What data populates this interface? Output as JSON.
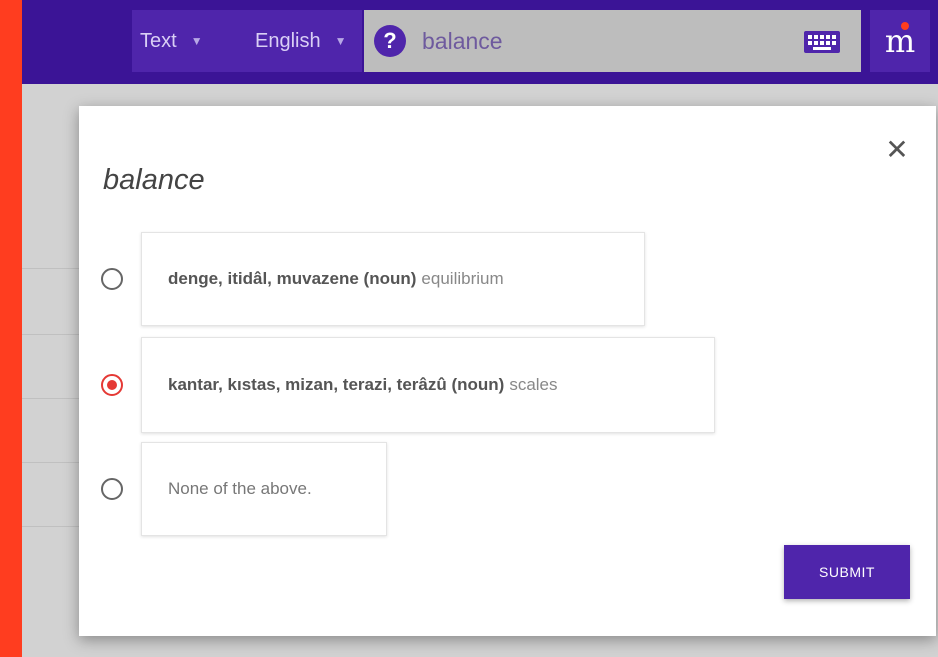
{
  "toolbar": {
    "mode_label": "Text",
    "language_label": "English",
    "search_value": "balance",
    "help_icon": "question-circle-icon",
    "keyboard_icon": "keyboard-icon",
    "brand_letter": "m"
  },
  "dialog": {
    "title": "balance",
    "close_symbol": "✕",
    "options": [
      {
        "terms": "denge, itidâl, muvazene (noun)",
        "gloss": "equilibrium",
        "selected": false
      },
      {
        "terms": "kantar, kıstas, mizan, terazi, terâzû (noun)",
        "gloss": "scales",
        "selected": true
      },
      {
        "terms": "",
        "gloss": "None of the above.",
        "selected": false
      }
    ],
    "submit_label": "SUBMIT"
  },
  "colors": {
    "topbar": "#3b1496",
    "accent": "#4f25ab",
    "brand_red": "#ff3d1f",
    "radio_selected": "#e53935"
  }
}
